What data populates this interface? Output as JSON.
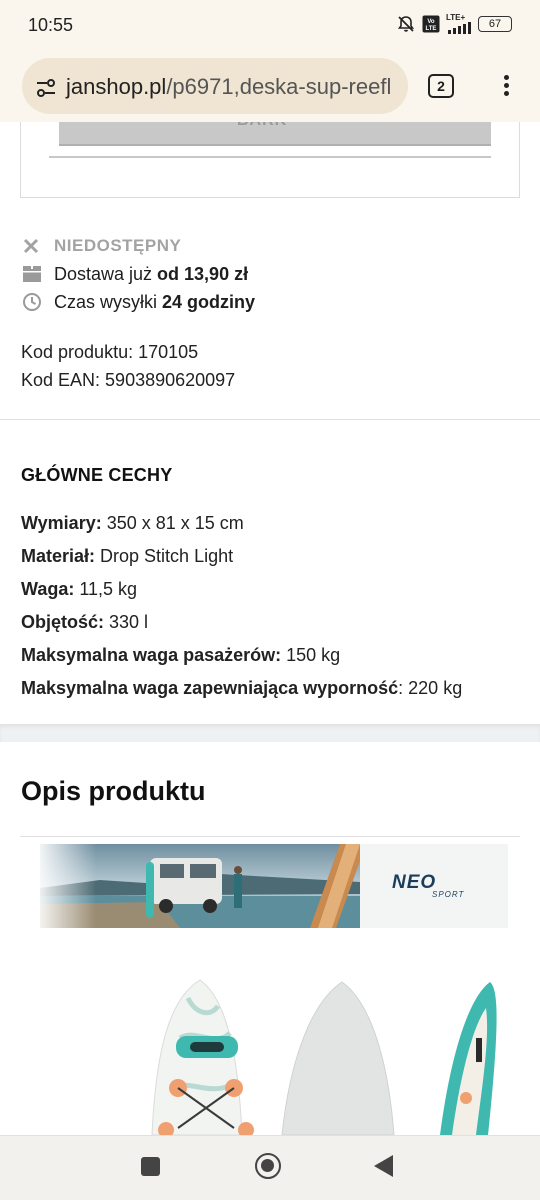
{
  "status_bar": {
    "time": "10:55",
    "network": "LTE+",
    "volte": "Vo LTE",
    "battery": "67"
  },
  "browser": {
    "url": "janshop.pl/p6971,deska-sup-reefl",
    "url_domain": "janshop.pl",
    "url_path": "/p6971,deska-sup-reefl",
    "tab_count": "2"
  },
  "top_box": {
    "button_label": "BARK"
  },
  "availability": {
    "status": "NIEDOSTĘPNY",
    "delivery_prefix": "Dostawa już ",
    "delivery_value": "od 13,90 zł",
    "shipping_prefix": "Czas wysyłki ",
    "shipping_value": "24 godziny"
  },
  "codes": {
    "product_code": "Kod produktu: 170105",
    "ean_code": "Kod EAN: 5903890620097"
  },
  "features": {
    "title": "GŁÓWNE CECHY",
    "items": [
      {
        "label": "Wymiary:",
        "value": " 350 x 81 x 15 cm"
      },
      {
        "label": "Materiał:",
        "value": " Drop Stitch Light"
      },
      {
        "label": "Waga:",
        "value": " 11,5 kg"
      },
      {
        "label": "Objętość:",
        "value": " 330 l"
      },
      {
        "label": "Maksymalna waga pasażerów:",
        "value": " 150 kg"
      },
      {
        "label": "Maksymalna waga zapewniająca wyporność",
        "value": ": 220 kg"
      }
    ]
  },
  "description": {
    "title": "Opis produktu",
    "banner_logo": "NEO",
    "banner_logo_sub": "SPORT"
  },
  "colors": {
    "url_bar_bg": "#faf6ee",
    "url_pill": "#efe5d2",
    "unavailable_gray": "#a3a3a3",
    "board_teal": "#3fb8b0",
    "board_orange": "#f0a070"
  }
}
